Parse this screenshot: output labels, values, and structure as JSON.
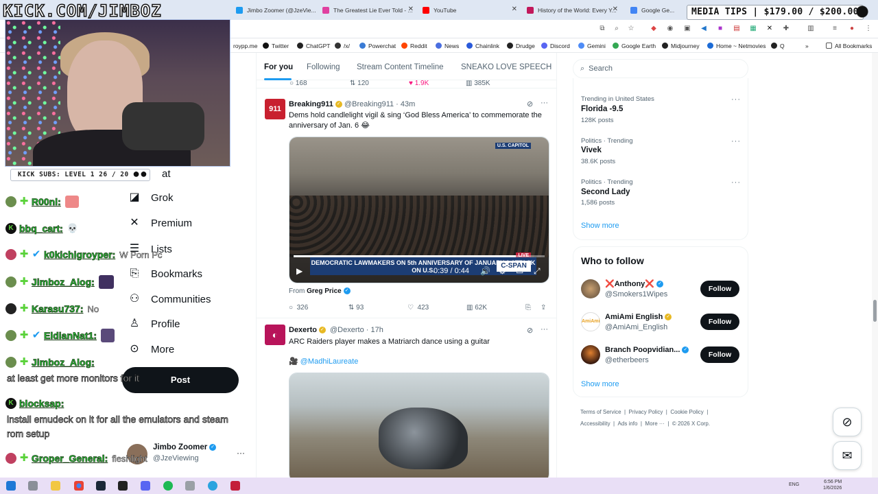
{
  "overlay": {
    "channel_title": "KICK.COM/JIMBOZ",
    "subs_counter": "KICK SUBS: LEVEL 1 26 / 20",
    "media_tips": "MEDIA TIPS | $179.00 / $200.00"
  },
  "browser": {
    "tabs": [
      {
        "label": "Jimbo Zoomer (@JzeVie...",
        "color": "#1d9bf0"
      },
      {
        "label": "The Greatest Lie Ever Told - ...",
        "color": "#e040a0"
      },
      {
        "label": "YouTube",
        "color": "#ff0000"
      },
      {
        "label": "History of the World: Every Y...",
        "color": "#c2185b"
      },
      {
        "label": "Google Ge...",
        "color": "#4285f4"
      }
    ],
    "bookmarks": [
      {
        "label": "roypp.me",
        "color": "#999999"
      },
      {
        "label": "Twitter",
        "color": "#111111"
      },
      {
        "label": "ChatGPT",
        "color": "#222222"
      },
      {
        "label": "/x/",
        "color": "#333333"
      },
      {
        "label": "Powerchat",
        "color": "#3a7bd5"
      },
      {
        "label": "Reddit",
        "color": "#ff4500"
      },
      {
        "label": "News",
        "color": "#4a6ee0"
      },
      {
        "label": "Chainlink",
        "color": "#2a5ada"
      },
      {
        "label": "Drudge",
        "color": "#222222"
      },
      {
        "label": "Discord",
        "color": "#5865f2"
      },
      {
        "label": "Gemini",
        "color": "#4e8cf7"
      },
      {
        "label": "Google Earth",
        "color": "#34a853"
      },
      {
        "label": "Midjourney",
        "color": "#222222"
      },
      {
        "label": "Home ~ Netmovies",
        "color": "#1c6bd6"
      },
      {
        "label": "Q",
        "color": "#222222"
      }
    ],
    "all_bookmarks": "All Bookmarks"
  },
  "chat": {
    "messages": [
      {
        "user": "R00nl:",
        "text": "",
        "avatar": "#6b8e4e"
      },
      {
        "user": "bbq_cart:",
        "text": "",
        "avatar": "#111111"
      },
      {
        "user": "k0kichigroyper:",
        "text": "W Porn Pc",
        "avatar": "#c04060"
      },
      {
        "user": "Jimboz_Alog:",
        "text": "",
        "avatar": "#6b8e4e"
      },
      {
        "user": "Karasu737:",
        "text": "No",
        "avatar": "#222222"
      },
      {
        "user": "EldianNat1:",
        "text": "",
        "avatar": "#6b8e4e"
      },
      {
        "user": "Jimboz_Alog:",
        "text": "",
        "avatar": "#6b8e4e"
      },
      {
        "user": "blocksap:",
        "text": "",
        "avatar": "#111111"
      },
      {
        "user": "Groper_General:",
        "text": "fleshlight",
        "avatar": "#c04060"
      }
    ],
    "jimboz_msg": "at least get more monitors for it",
    "blocksap_msg": "install emudeck on it for all the emulators and steam rom setup"
  },
  "nav": {
    "partial_top": "at",
    "grok": "Grok",
    "premium": "Premium",
    "lists": "Lists",
    "bookmarks": "Bookmarks",
    "communities": "Communities",
    "profile": "Profile",
    "more": "More",
    "post": "Post",
    "account_name": "Jimbo Zoomer",
    "account_handle": "@JzeViewing"
  },
  "timeline": {
    "tabs": [
      "For you",
      "Following",
      "Stream Content Timeline",
      "SNEAKO LOVE SPEECH"
    ],
    "top_stats": {
      "replies": "168",
      "reposts": "120",
      "likes": "1.9K",
      "views": "385K"
    },
    "tweet1": {
      "name": "Breaking911",
      "handle": "@Breaking911 · 43m",
      "text": "Dems hold candlelight vigil & sing ‘God Bless America’ to commemorate the anniversary of Jan. 6 😂",
      "video_banner": "DEMOCRATIC LAWMAKERS ON 5th ANNIVERSARY OF JANUARY 6 ATTACK ON U.S.",
      "network": "C-SPAN",
      "location_badge": "U.S. CAPITOL",
      "live_badge": "LIVE",
      "video_time": "0:39 / 0:44",
      "progress": 0.886,
      "from_label": "From",
      "from_name": "Greg Price",
      "replies": "326",
      "reposts": "93",
      "likes": "423",
      "views": "62K"
    },
    "tweet2": {
      "name": "Dexerto",
      "handle": "@Dexerto · 17h",
      "text": "ARC Raiders player makes a Matriarch dance using a guitar",
      "credit": "@MadhiLaureate"
    }
  },
  "sidebar": {
    "search_placeholder": "Search",
    "trends": [
      {
        "meta": "Trending in United States",
        "name": "Florida -9.5",
        "posts": "128K posts"
      },
      {
        "meta": "Politics · Trending",
        "name": "Vivek",
        "posts": "38.6K posts"
      },
      {
        "meta": "Politics · Trending",
        "name": "Second Lady",
        "posts": "1,586 posts"
      }
    ],
    "show_more": "Show more",
    "who_to_follow": "Who to follow",
    "follow_suggestions": [
      {
        "name": "❌Anthony❌",
        "handle": "@Smokers1Wipes",
        "button": "Follow"
      },
      {
        "name": "AmiAmi English",
        "handle": "@AmiAmi_English",
        "button": "Follow"
      },
      {
        "name": "Branch Poopvidian...",
        "handle": "@etherbeers",
        "button": "Follow"
      }
    ],
    "footer_row1": [
      "Terms of Service",
      "Privacy Policy",
      "Cookie Policy"
    ],
    "footer_row2": [
      "Accessibility",
      "Ads info",
      "More ···",
      "© 2026 X Corp."
    ]
  },
  "taskbar": {
    "lang": "ENG",
    "time": "6:56 PM",
    "date": "1/6/2026"
  }
}
